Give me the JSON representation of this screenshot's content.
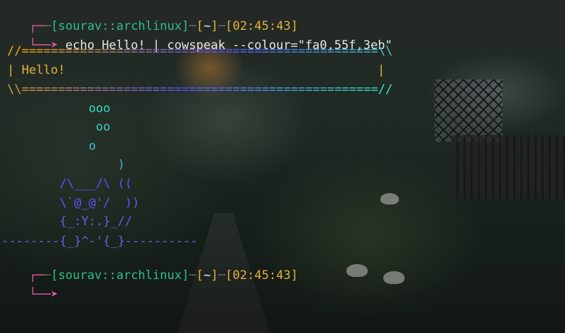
{
  "prompt_1": {
    "user": "sourav",
    "sep": "::",
    "host": "archlinux",
    "dir": "~",
    "time": "02:45:43",
    "command": "echo Hello! | cowspeak --colour=\"fa0,55f,3eb\""
  },
  "output": {
    "bubble_top": "//=================================================\\\\",
    "bubble_mid": "| Hello!                                           |",
    "bubble_bot": "\\\\=================================================//",
    "cow_lines": [
      "            ooo",
      "             oo",
      "            o",
      "                )",
      "        /\\___/\\ ((",
      "        \\`@_@'/  ))",
      "        {_:Y:.}_//",
      "--------{_}^-'{_}----------"
    ]
  },
  "prompt_2": {
    "user": "sourav",
    "sep": "::",
    "host": "archlinux",
    "dir": "~",
    "time": "02:45:43"
  },
  "colors": {
    "accent_pink": "#e05aa8",
    "prompt_green": "#2fbf8a",
    "prompt_yellow": "#e3b13a",
    "text": "#e8e8e8"
  }
}
